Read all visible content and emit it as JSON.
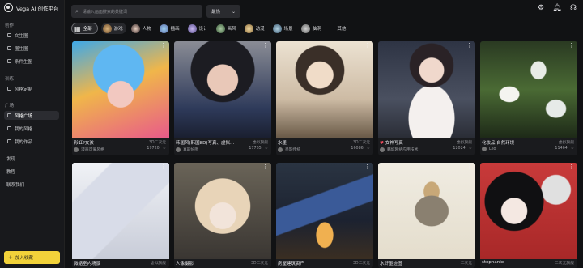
{
  "app": {
    "title": "Vega AI 创作平台"
  },
  "sidebar": {
    "sections": [
      {
        "label": "创作",
        "items": [
          "文生图",
          "图生图",
          "条件生图"
        ]
      },
      {
        "label": "训练",
        "items": [
          "风格定制"
        ]
      },
      {
        "label": "广场",
        "items": [
          "风格广场",
          "我的风格",
          "我的作品"
        ]
      }
    ],
    "links": [
      "发现",
      "教程",
      "联系我们"
    ],
    "favorite_label": "加入收藏",
    "active_item": "风格广场"
  },
  "topbar": {
    "search_placeholder": "请输入画面搜索的关键词",
    "sort_value": "最热",
    "icons": [
      "settings-icon",
      "bell-icon",
      "headset-icon"
    ]
  },
  "categories": [
    {
      "label": "全部",
      "selected": true
    },
    {
      "label": "游戏",
      "selected": true
    },
    {
      "label": "人物"
    },
    {
      "label": "插画"
    },
    {
      "label": "设计"
    },
    {
      "label": "画风"
    },
    {
      "label": "动漫"
    },
    {
      "label": "场景"
    },
    {
      "label": "脑洞"
    },
    {
      "label": "其他"
    }
  ],
  "cards": [
    {
      "title": "彩虹?女孩",
      "meta": "3D二次元",
      "user": "漫画可爱风格",
      "likes": "19720"
    },
    {
      "title": "韩国风(韩国8D)写真、虚拟...",
      "meta": "虚拟旗舰",
      "user": "真的好图",
      "likes": "17765"
    },
    {
      "title": "水墨",
      "meta": "3D二次元",
      "user": "墨韵传统",
      "likes": "16086"
    },
    {
      "title": "女神写真",
      "meta": "虚拟旗舰",
      "user": "韩城网络应用技术",
      "likes": "12024"
    },
    {
      "title": "化妆品·自然环境",
      "meta": "虚拟旗舰",
      "user": "Leo",
      "likes": "11464"
    },
    {
      "title": "微缩室内场景",
      "meta": "虚拟旗舰",
      "user": "",
      "likes": ""
    },
    {
      "title": "人像摄影",
      "meta": "3D二次元",
      "user": "",
      "likes": ""
    },
    {
      "title": "房屋建筑资产",
      "meta": "3D二次元",
      "user": "",
      "likes": ""
    },
    {
      "title": "水浒墨迹图",
      "meta": "二次元",
      "user": "",
      "likes": ""
    },
    {
      "title": "stephanie",
      "meta": "二次元旗舰",
      "user": "",
      "likes": ""
    }
  ],
  "colors": {
    "accent": "#f2d23a",
    "bg": "#111214",
    "sidebar": "#18191c"
  }
}
